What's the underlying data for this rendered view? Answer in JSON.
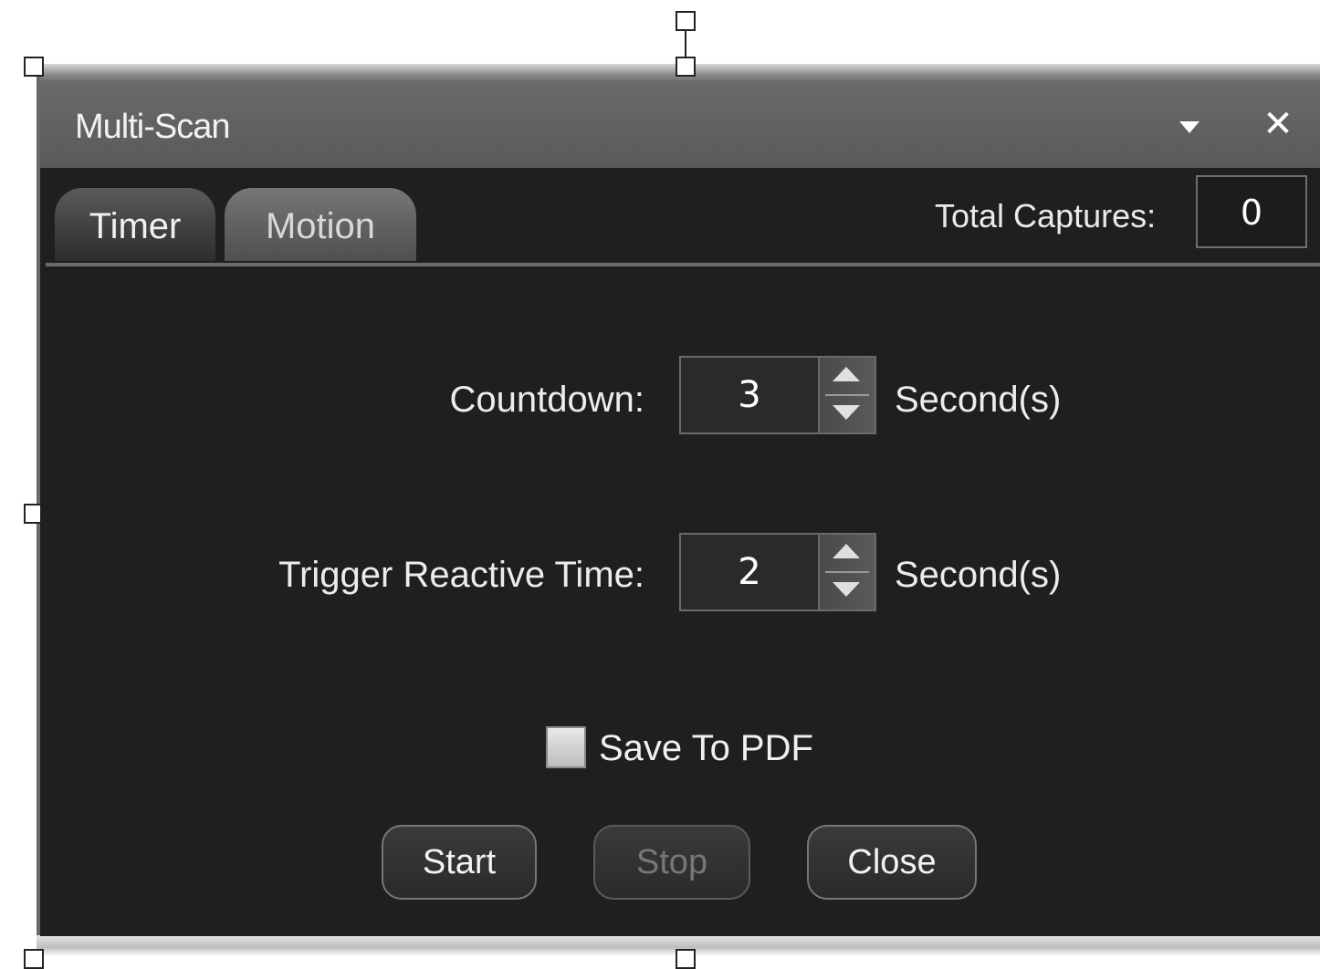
{
  "window": {
    "title": "Multi-Scan",
    "close_glyph": "✕"
  },
  "tabs": [
    {
      "label": "Timer",
      "active": true
    },
    {
      "label": "Motion",
      "active": false
    }
  ],
  "total_captures": {
    "label": "Total Captures:",
    "value": "0"
  },
  "fields": {
    "countdown": {
      "label": "Countdown:",
      "value": "3",
      "unit": "Second(s)"
    },
    "trigger": {
      "label": "Trigger Reactive Time:",
      "value": "2",
      "unit": "Second(s)"
    }
  },
  "save_pdf": {
    "label": "Save To PDF",
    "checked": false
  },
  "buttons": {
    "start": "Start",
    "stop": "Stop",
    "close": "Close"
  },
  "colors": {
    "window_bg": "#1f1f1f",
    "titlebar": "#5f5f5f",
    "disabled_text": "#777777"
  }
}
